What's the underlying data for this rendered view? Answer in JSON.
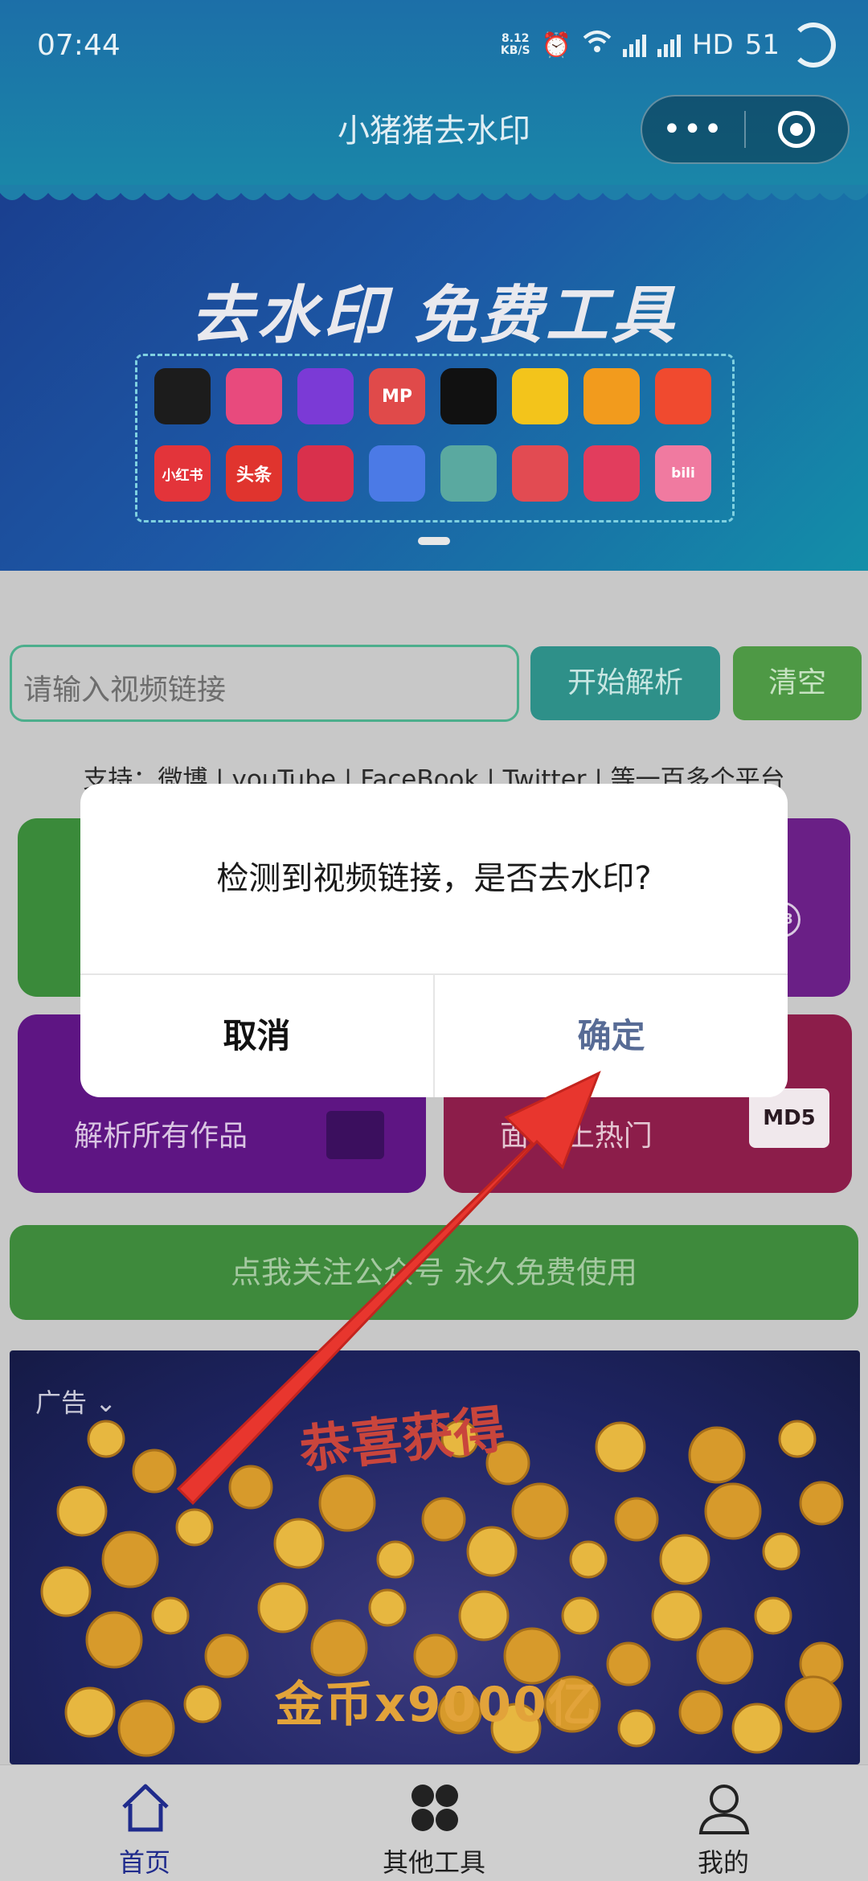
{
  "status_bar": {
    "time": "07:44",
    "speed_top": "8.12",
    "speed_unit": "KB/S",
    "network_a": "4G",
    "network_b": "4G",
    "hd": "HD",
    "battery": "51"
  },
  "nav": {
    "title": "小猪猪去水印",
    "more_glyph": "•••"
  },
  "banner": {
    "title": "去水印 免费工具",
    "logos": [
      "douyin",
      "pipixia",
      "weishi",
      "meipai",
      "xigua",
      "huoshan",
      "kuaishou",
      "huoshan-flame",
      "小红书",
      "头条",
      "weibo-video",
      "momo",
      "owl",
      "troll",
      "haokan",
      "bilibili"
    ],
    "logo_colors": [
      "#1c1c1c",
      "#e84a7d",
      "#7b3ad6",
      "#e04a4a",
      "#111111",
      "#f3c41b",
      "#f29b1d",
      "#f04a2f",
      "#e3343a",
      "#e0342e",
      "#d9304c",
      "#4b7ae6",
      "#5aa9a0",
      "#e24b52",
      "#e23d5d",
      "#f07aa0"
    ],
    "logo_text": [
      "",
      "",
      "",
      "MP",
      "",
      "",
      "",
      "",
      "小红书",
      "头条",
      "",
      "",
      "",
      "",
      "",
      "bili"
    ]
  },
  "input": {
    "placeholder": "请输入视频链接"
  },
  "buttons": {
    "parse": "开始解析",
    "clear": "清空"
  },
  "support_text": "支持：微博 | youTube | FaceBook | Twitter | 等一百多个平台",
  "cards": {
    "bottom_left_text": "解析所有作品",
    "bottom_right_text": "5上热门",
    "bottom_right_prefix": "面",
    "badge": "18",
    "md5": "MD5"
  },
  "follow_button": "点我关注公众号 永久免费使用",
  "ad": {
    "label": "广告",
    "headline": "恭喜获得",
    "coin_text": "金币x9000亿"
  },
  "dialog": {
    "message": "检测到视频链接，是否去水印?",
    "cancel": "取消",
    "confirm": "确定"
  },
  "tabs": [
    {
      "label": "首页",
      "icon": "home-icon"
    },
    {
      "label": "其他工具",
      "icon": "apps-icon"
    },
    {
      "label": "我的",
      "icon": "user-icon"
    }
  ],
  "colors": {
    "accent_active_tab": "#1f2b8c",
    "dialog_confirm": "#576b95",
    "annotation_arrow": "#e8362e"
  }
}
